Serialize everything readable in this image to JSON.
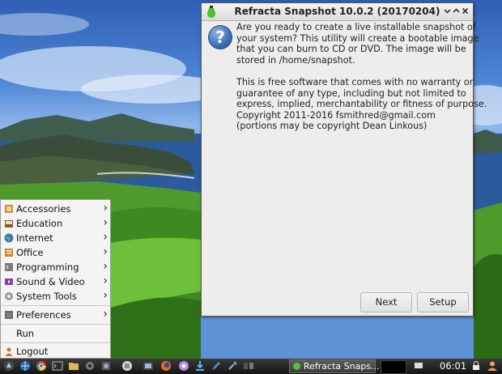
{
  "dialog": {
    "title": "Refracta Snapshot 10.0.2 (20170204)",
    "minimize_icon": "chevron-down-icon",
    "maximize_icon": "chevron-up-icon",
    "close_icon": "close-icon",
    "message_icon": "question-icon",
    "message_icon_glyph": "?",
    "paragraph1": [
      "Are you ready to create a live installable snapshot of",
      "your system? This utility will create a bootable image",
      "that you can burn to CD or DVD. The image will be",
      "stored in /home/snapshot."
    ],
    "paragraph2": [
      "This is free software that comes with no warranty or",
      "guarantee of any type, including but not limited to",
      "express, implied, merchantability or fitness of purpose.",
      "Copyright 2011-2016 fsmithred@gmail.com",
      "(portions may be copyright Dean Linkous)"
    ],
    "buttons": {
      "next": "Next",
      "setup": "Setup"
    }
  },
  "menu": {
    "items": [
      {
        "label": "Accessories",
        "icon": "accessories-icon",
        "submenu": true
      },
      {
        "label": "Education",
        "icon": "education-icon",
        "submenu": true
      },
      {
        "label": "Internet",
        "icon": "globe-icon",
        "submenu": true
      },
      {
        "label": "Office",
        "icon": "office-icon",
        "submenu": true
      },
      {
        "label": "Programming",
        "icon": "programming-icon",
        "submenu": true
      },
      {
        "label": "Sound & Video",
        "icon": "sound-video-icon",
        "submenu": true
      },
      {
        "label": "System Tools",
        "icon": "gear-icon",
        "submenu": true
      }
    ],
    "preferences": {
      "label": "Preferences",
      "icon": "preferences-icon",
      "submenu": true
    },
    "run": {
      "label": "Run"
    },
    "logout": {
      "label": "Logout",
      "icon": "logout-icon"
    },
    "arrow_glyph": "›"
  },
  "taskbar": {
    "launchers": [
      "start-menu-icon",
      "browser-icon",
      "chrome-icon",
      "terminal-icon",
      "folder-icon",
      "settings-icon",
      "network-icon",
      "files-icon",
      "firefox-icon",
      "media-icon",
      "utility-icon",
      "download-icon",
      "editor-icon",
      "tools-icon"
    ],
    "task": {
      "label": "Refracta Snaps...",
      "icon": "refracta-icon"
    },
    "clock": "06:01",
    "tray": [
      "workspace-indicator",
      "lock-icon",
      "screen-icon",
      "user-icon"
    ]
  },
  "colors": {
    "dialog_bg": "#ededec",
    "menu_bg": "#f4f4f4",
    "taskbar_bg": "#1e1e1e",
    "icon_blue": "#3b6fb8",
    "accent_green": "#52c23a"
  }
}
